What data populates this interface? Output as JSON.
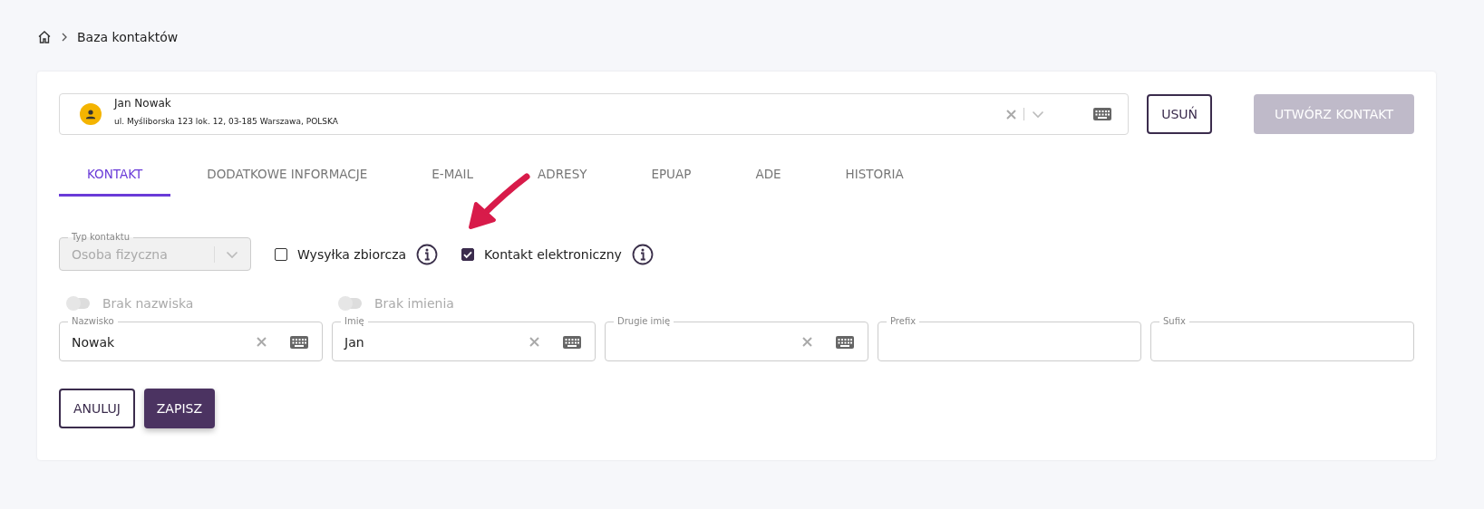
{
  "breadcrumb": {
    "current": "Baza kontaktów"
  },
  "contact_picker": {
    "name": "Jan Nowak",
    "address": "ul. Myśliborska 123 lok. 12, 03-185 Warszawa, POLSKA"
  },
  "header_buttons": [
    {
      "label": "USUŃ",
      "kind": "outline",
      "disabled": false
    },
    {
      "label": "UTWÓRZ KONTAKT",
      "kind": "filled",
      "disabled": true
    }
  ],
  "tabs": [
    {
      "label": "KONTAKT",
      "selected": true
    },
    {
      "label": "DODATKOWE INFORMACJE",
      "selected": false
    },
    {
      "label": "E-MAIL",
      "selected": false
    },
    {
      "label": "ADRESY",
      "selected": false
    },
    {
      "label": "EPUAP",
      "selected": false
    },
    {
      "label": "ADE",
      "selected": false
    },
    {
      "label": "HISTORIA",
      "selected": false
    }
  ],
  "contact_type": {
    "label": "Typ kontaktu",
    "value": "Osoba fizyczna",
    "disabled": true
  },
  "checkboxes": [
    {
      "label": "Wysyłka zbiorcza",
      "checked": false
    },
    {
      "label": "Kontakt elektroniczny",
      "checked": true
    }
  ],
  "toggles": [
    {
      "label": "Brak nazwiska",
      "on": false,
      "disabled": true
    },
    {
      "label": "Brak imienia",
      "on": false,
      "disabled": true
    }
  ],
  "fields": [
    {
      "label": "Nazwisko",
      "value": "Nowak",
      "clearable": true,
      "keyboard": true
    },
    {
      "label": "Imię",
      "value": "Jan",
      "clearable": true,
      "keyboard": true
    },
    {
      "label": "Drugie imię",
      "clearable": true,
      "keyboard": true
    },
    {
      "label": "Prefix",
      "clearable": false,
      "keyboard": false
    },
    {
      "label": "Sufix",
      "clearable": false,
      "keyboard": false
    }
  ],
  "footer_buttons": [
    {
      "label": "ANULUJ",
      "kind": "outline"
    },
    {
      "label": "ZAPISZ",
      "kind": "filled"
    }
  ]
}
